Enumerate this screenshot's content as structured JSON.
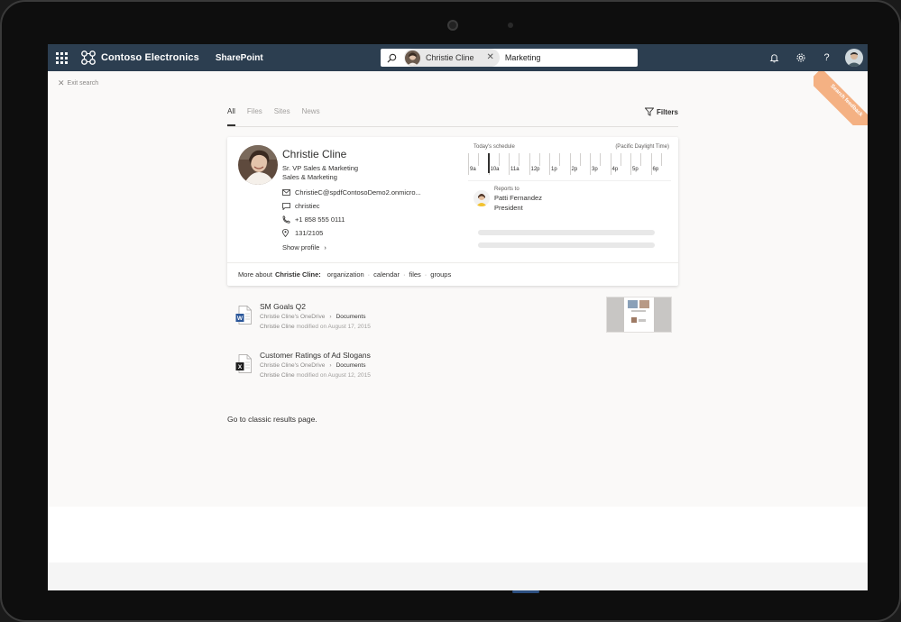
{
  "suitebar": {
    "brand": "Contoso Electronics",
    "app": "SharePoint",
    "search_person": "Christie Cline",
    "search_term": "Marketing",
    "question": "?"
  },
  "ribbon": {
    "text": "Search feedback"
  },
  "exit_search": "Exit search",
  "tabs": [
    "All",
    "Files",
    "Sites",
    "News"
  ],
  "filters_label": "Filters",
  "person": {
    "name": "Christie Cline",
    "title": "Sr. VP Sales & Marketing",
    "department": "Sales & Marketing",
    "email": "ChristieC@spdfContosoDemo2.onmicro...",
    "chat": "christiec",
    "phone": "+1 858 555 0111",
    "office": "131/2105",
    "show_profile": "Show profile"
  },
  "schedule": {
    "label": "Today's schedule",
    "timezone": "(Pacific Daylight Time)",
    "hours": [
      "9a",
      "10a",
      "11a",
      "12p",
      "1p",
      "2p",
      "3p",
      "4p",
      "5p",
      "6p"
    ]
  },
  "reports_to": {
    "label": "Reports to",
    "name": "Patti Fernandez",
    "role": "President"
  },
  "more_about": {
    "prefix": "More about",
    "name": "Christie Cline:",
    "links": [
      "organization",
      "calendar",
      "files",
      "groups"
    ],
    "separator": "·"
  },
  "results": [
    {
      "title": "SM Goals Q2",
      "source": "Christie Cline's OneDrive",
      "folder": "Documents",
      "author": "Christie Cline",
      "modified": "modified on August 17, 2015",
      "type": "word"
    },
    {
      "title": "Customer Ratings of Ad Slogans",
      "source": "Christie Cline's OneDrive",
      "folder": "Documents",
      "author": "Christie Cline",
      "modified": "modified on August 12, 2015",
      "type": "excel"
    }
  ],
  "classic_link": "Go to classic results page.",
  "colors": {
    "suitebar": "#2c3e50",
    "ribbon": "#f4b183",
    "word": "#2b579a",
    "excel": "#1e1e1e"
  }
}
